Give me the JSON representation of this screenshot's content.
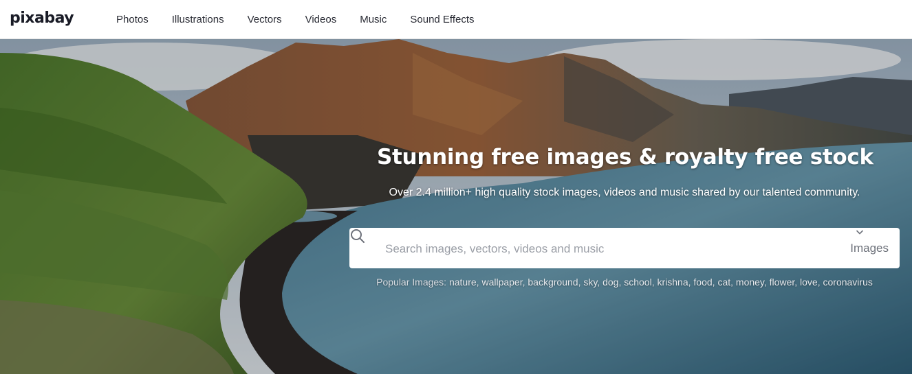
{
  "brand": {
    "logo_text": "pixabay"
  },
  "nav": {
    "items": [
      {
        "label": "Photos"
      },
      {
        "label": "Illustrations"
      },
      {
        "label": "Vectors"
      },
      {
        "label": "Videos"
      },
      {
        "label": "Music"
      },
      {
        "label": "Sound Effects"
      }
    ]
  },
  "hero": {
    "headline": "Stunning free images & royalty free stock",
    "subline": "Over 2.4 million+ high quality stock images, videos and music shared by our talented community."
  },
  "search": {
    "placeholder": "Search images, vectors, videos and music",
    "value": "",
    "type_selected": "Images",
    "icon": "search-icon"
  },
  "popular": {
    "label": "Popular Images:",
    "tags": [
      "nature",
      "wallpaper",
      "background",
      "sky",
      "dog",
      "school",
      "krishna",
      "food",
      "cat",
      "money",
      "flower",
      "love",
      "coronavirus"
    ]
  },
  "colors": {
    "header_bg": "#ffffff",
    "nav_text": "#2b2d36",
    "hero_text": "#ffffff",
    "search_placeholder": "#9a9ea6"
  }
}
